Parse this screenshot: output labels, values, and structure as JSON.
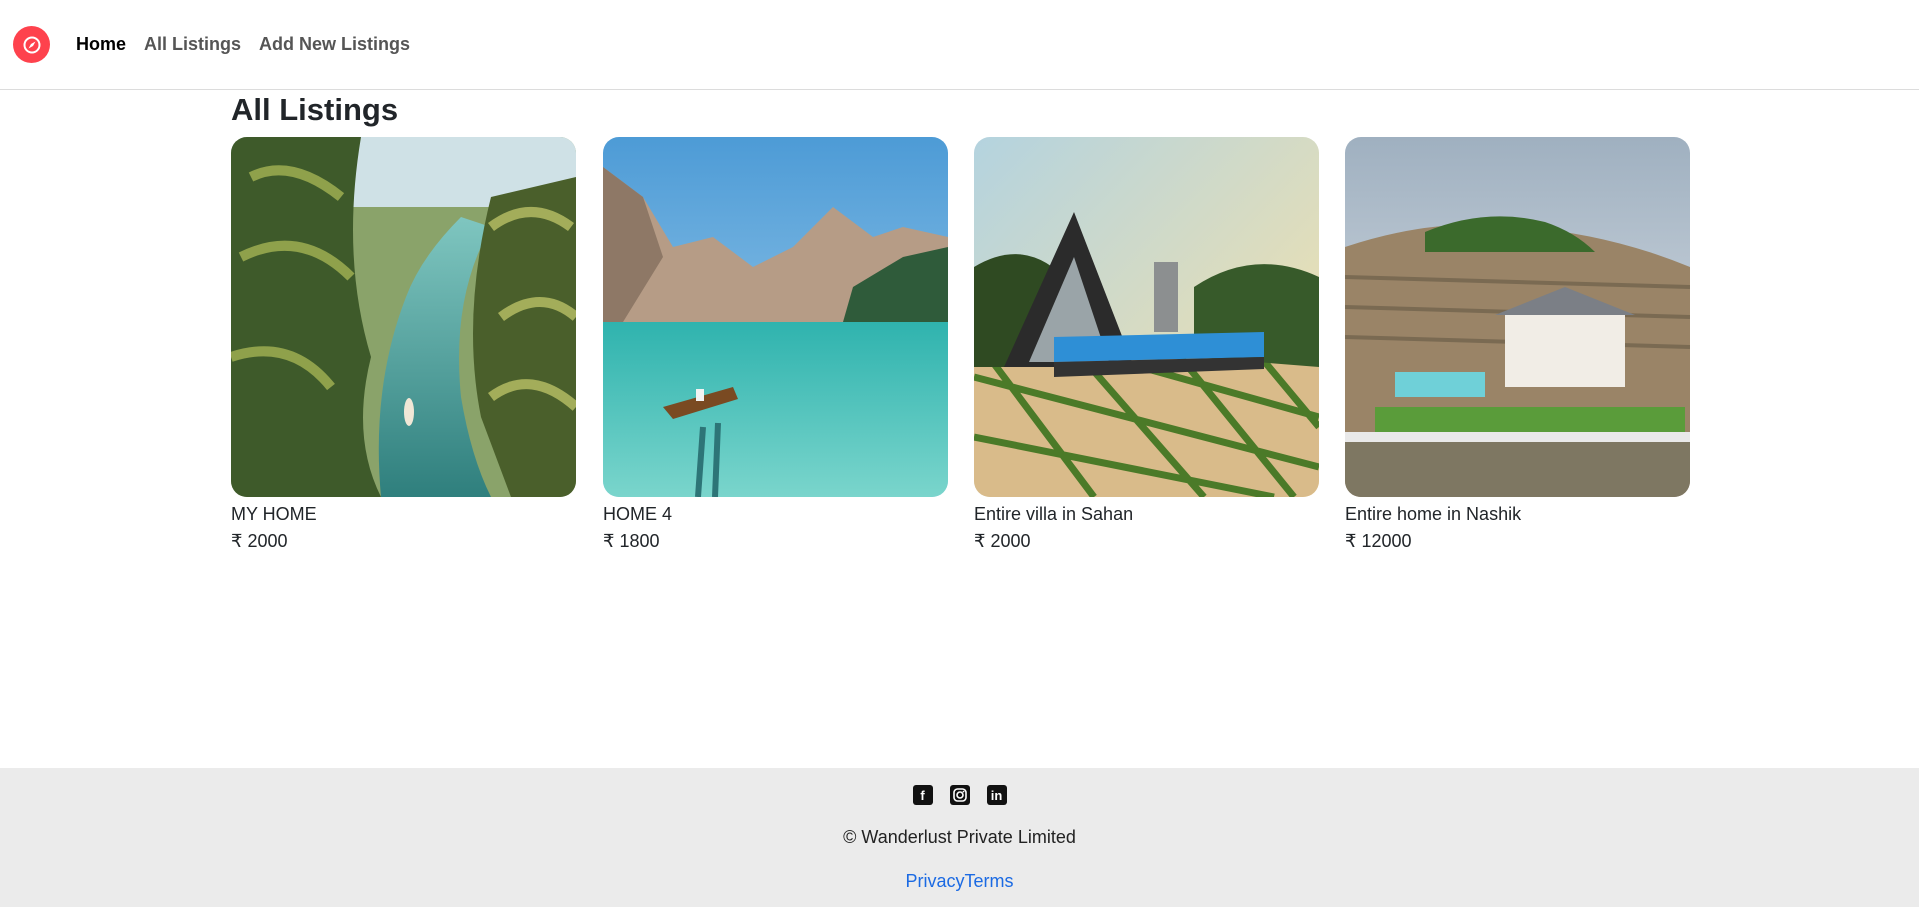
{
  "nav": {
    "brand_icon": "compass-icon",
    "brand_color": "#fe424d",
    "links": [
      "Home",
      "All Listings",
      "Add New Listings"
    ]
  },
  "main": {
    "title": "All Listings",
    "listings": [
      {
        "title": "MY HOME",
        "price": "₹ 2000",
        "image": "tropical-river-canoe-photo"
      },
      {
        "title": "HOME 4",
        "price": "₹ 1800",
        "image": "mountain-lake-boat-photo"
      },
      {
        "title": "Entire villa in Sahan",
        "price": "₹ 2000",
        "image": "a-frame-villa-pool-photo"
      },
      {
        "title": "Entire home in Nashik",
        "price": "₹ 12000",
        "image": "hillside-mansion-pool-photo"
      }
    ]
  },
  "footer": {
    "socials": [
      "facebook-icon",
      "instagram-icon",
      "linkedin-icon"
    ],
    "copyright": "© Wanderlust Private Limited",
    "privacy": "Privacy",
    "terms": "Terms"
  }
}
